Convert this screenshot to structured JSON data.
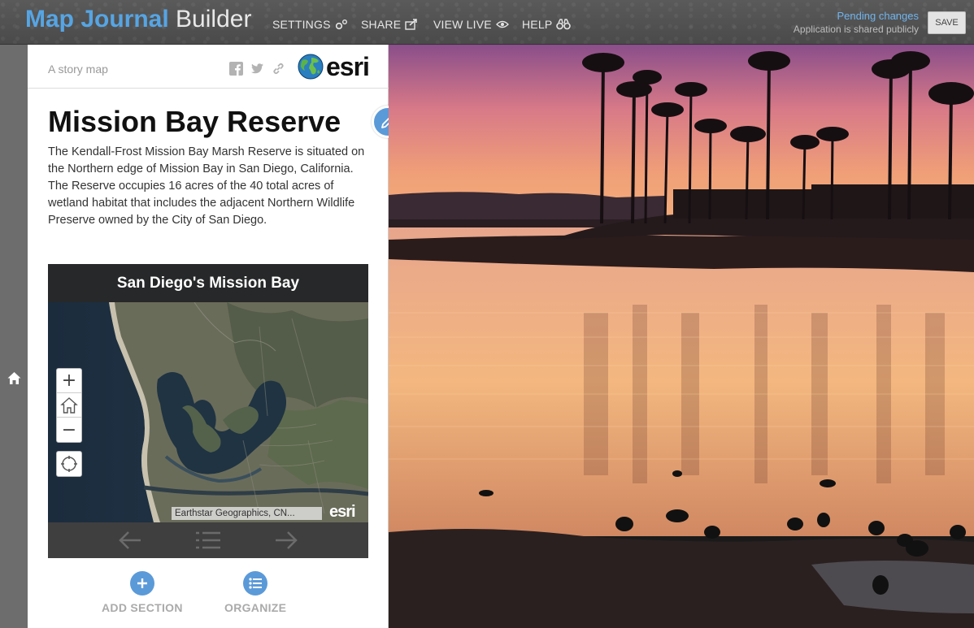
{
  "app": {
    "brand_primary": "Map Journal",
    "brand_secondary": "Builder",
    "accent_color": "#56a5e4"
  },
  "topnav": [
    {
      "label": "SETTINGS",
      "icon": "gears-icon"
    },
    {
      "label": "SHARE",
      "icon": "share-icon"
    },
    {
      "label": "VIEW LIVE",
      "icon": "eye-icon"
    },
    {
      "label": "HELP",
      "icon": "binoculars-icon"
    }
  ],
  "status": {
    "pending": "Pending changes",
    "shared": "Application is shared publicly",
    "save_label": "SAVE"
  },
  "panel": {
    "tagline": "A story map",
    "social_icons": [
      "facebook-icon",
      "twitter-icon",
      "link-icon"
    ],
    "logo_text": "esri",
    "title": "Mission Bay Reserve",
    "description": "The Kendall-Frost Mission Bay Marsh Reserve is situated on the Northern edge of Mission Bay in San Diego, California. The Reserve occupies 16 acres of the 40 total acres of wetland habitat that includes the adjacent Northern Wildlife Preserve owned by the City of San Diego."
  },
  "map": {
    "title": "San Diego's Mission Bay",
    "attribution": "Earthstar Geographics, CN...",
    "logo_text": "esri",
    "controls": {
      "zoom_in": "+",
      "zoom_out": "−"
    }
  },
  "actions": {
    "add_section": "ADD SECTION",
    "organize": "ORGANIZE"
  }
}
